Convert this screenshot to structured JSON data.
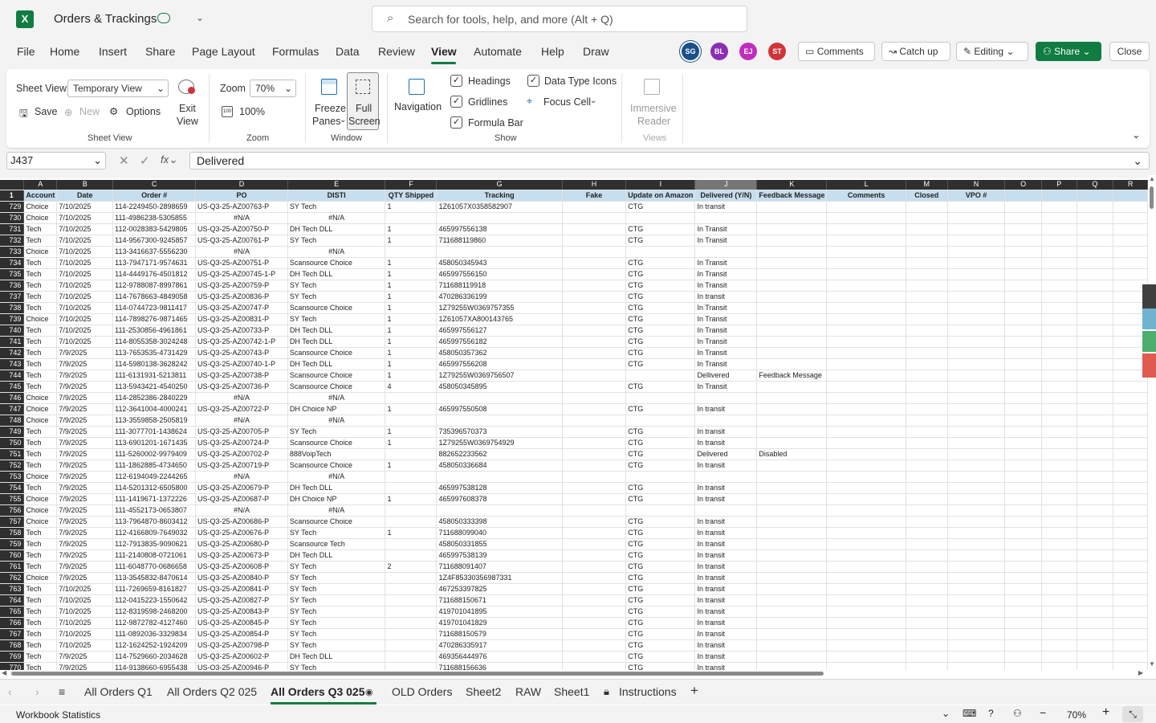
{
  "app": {
    "title": "Orders & Trackings",
    "search_placeholder": "Search for tools, help, and more (Alt + Q)",
    "logo_letter": "X"
  },
  "menu": [
    "File",
    "Home",
    "Insert",
    "Share",
    "Page Layout",
    "Formulas",
    "Data",
    "Review",
    "View",
    "Automate",
    "Help",
    "Draw"
  ],
  "active_menu": "View",
  "avatars": [
    {
      "initials": "SG",
      "color": "#1b4f8a"
    },
    {
      "initials": "BL",
      "color": "#8a2fb5"
    },
    {
      "initials": "EJ",
      "color": "#c02dbd"
    },
    {
      "initials": "ST",
      "color": "#d13438"
    }
  ],
  "top_buttons": {
    "comments": "Comments",
    "catchup": "Catch up",
    "editing": "Editing",
    "share": "Share",
    "close": "Close"
  },
  "ribbon": {
    "sheet_view_label": "Sheet View",
    "sheet_view_value": "Temporary View",
    "save": "Save",
    "new": "New",
    "options": "Options",
    "exit_view_1": "Exit",
    "exit_view_2": "View",
    "group_sheet_view": "Sheet View",
    "zoom_label": "Zoom",
    "zoom_value": "70%",
    "zoom_100": "100%",
    "group_zoom": "Zoom",
    "freeze_1": "Freeze",
    "freeze_2": "Panes",
    "full_1": "Full",
    "full_2": "Screen",
    "group_window": "Window",
    "navigation": "Navigation",
    "headings": "Headings",
    "gridlines": "Gridlines",
    "formula_bar": "Formula Bar",
    "data_type_icons": "Data Type Icons",
    "focus_cell": "Focus Cell",
    "group_show": "Show",
    "immersive_1": "Immersive",
    "immersive_2": "Reader",
    "group_views": "Views"
  },
  "formula_bar": {
    "cell_ref": "J437",
    "value": "Delivered"
  },
  "columns": [
    "A",
    "B",
    "C",
    "D",
    "E",
    "F",
    "G",
    "H",
    "I",
    "J",
    "K",
    "L",
    "M",
    "N",
    "O",
    "P",
    "Q",
    "R"
  ],
  "selected_column": "J",
  "header_row": {
    "row": "1",
    "cells": [
      "Account",
      "Date",
      "Order #",
      "PO",
      "DISTI",
      "QTY Shipped",
      "Tracking",
      "Fake",
      "Update on Amazon",
      "Delivered (Y/N)",
      "Feedback Message",
      "Comments",
      "Closed",
      "VPO #",
      "",
      "",
      "",
      ""
    ]
  },
  "rows": [
    [
      "729",
      "Choice",
      "7/10/2025",
      "114-2249450-2898659",
      "US-Q3-25-AZ00763-P",
      "SY Tech",
      "1",
      "1Z61057X0358582907",
      "",
      "CTG",
      "In transit",
      "",
      "",
      "",
      "",
      "",
      "",
      "",
      ""
    ],
    [
      "730",
      "Choice",
      "7/10/2025",
      "111-4986238-5305855",
      "#N/A",
      "#N/A",
      "",
      "",
      "",
      "",
      "",
      "",
      "",
      "",
      "",
      "",
      "",
      "",
      ""
    ],
    [
      "731",
      "Tech",
      "7/10/2025",
      "112-0028383-5429805",
      "US-Q3-25-AZ00750-P",
      "DH Tech DLL",
      "1",
      "465997556138",
      "",
      "CTG",
      "In Transit",
      "",
      "",
      "",
      "",
      "",
      "",
      "",
      ""
    ],
    [
      "732",
      "Tech",
      "7/10/2025",
      "114-9567300-9245857",
      "US-Q3-25-AZ00761-P",
      "SY Tech",
      "1",
      "711688119860",
      "",
      "CTG",
      "In Transit",
      "",
      "",
      "",
      "",
      "",
      "",
      "",
      ""
    ],
    [
      "733",
      "Choice",
      "7/10/2025",
      "113-3416637-5556230",
      "#N/A",
      "#N/A",
      "",
      "",
      "",
      "",
      "",
      "",
      "",
      "",
      "",
      "",
      "",
      "",
      ""
    ],
    [
      "734",
      "Tech",
      "7/10/2025",
      "113-7947171-9574631",
      "US-Q3-25-AZ00751-P",
      "Scansource Choice",
      "1",
      "458050345943",
      "",
      "CTG",
      "In Transit",
      "",
      "",
      "",
      "",
      "",
      "",
      "",
      ""
    ],
    [
      "735",
      "Tech",
      "7/10/2025",
      "114-4449176-4501812",
      "US-Q3-25-AZ00745-1-P",
      "DH Tech DLL",
      "1",
      "465997556150",
      "",
      "CTG",
      "In Transit",
      "",
      "",
      "",
      "",
      "",
      "",
      "",
      ""
    ],
    [
      "736",
      "Tech",
      "7/10/2025",
      "112-9788087-8997861",
      "US-Q3-25-AZ00759-P",
      "SY Tech",
      "1",
      "711688119918",
      "",
      "CTG",
      "In Transit",
      "",
      "",
      "",
      "",
      "",
      "",
      "",
      ""
    ],
    [
      "737",
      "Tech",
      "7/10/2025",
      "114-7678663-4849058",
      "US-Q3-25-AZ00836-P",
      "SY Tech",
      "1",
      "470286336199",
      "",
      "CTG",
      "In transit",
      "",
      "",
      "",
      "",
      "",
      "",
      "",
      ""
    ],
    [
      "738",
      "Tech",
      "7/10/2025",
      "114-0744723-9811417",
      "US-Q3-25-AZ00747-P",
      "Scansource Choice",
      "1",
      "1Z79255W0369757355",
      "",
      "CTG",
      "In Transit",
      "",
      "",
      "",
      "",
      "",
      "",
      "",
      ""
    ],
    [
      "739",
      "Choice",
      "7/10/2025",
      "114-7898276-9871465",
      "US-Q3-25-AZ00831-P",
      "SY Tech",
      "1",
      "1Z61057XA800143765",
      "",
      "CTG",
      "In Transit",
      "",
      "",
      "",
      "",
      "",
      "",
      "",
      ""
    ],
    [
      "740",
      "Tech",
      "7/10/2025",
      "111-2530856-4961861",
      "US-Q3-25-AZ00733-P",
      "DH Tech DLL",
      "1",
      "465997556127",
      "",
      "CTG",
      "In Transit",
      "",
      "",
      "",
      "",
      "",
      "",
      "",
      ""
    ],
    [
      "741",
      "Tech",
      "7/10/2025",
      "114-8055358-3024248",
      "US-Q3-25-AZ00742-1-P",
      "DH Tech DLL",
      "1",
      "465997556182",
      "",
      "CTG",
      "In Transit",
      "",
      "",
      "",
      "",
      "",
      "",
      "",
      ""
    ],
    [
      "742",
      "Tech",
      "7/9/2025",
      "113-7653535-4731429",
      "US-Q3-25-AZ00743-P",
      "Scansource Choice",
      "1",
      "458050357362",
      "",
      "CTG",
      "In Transit",
      "",
      "",
      "",
      "",
      "",
      "",
      "",
      ""
    ],
    [
      "743",
      "Tech",
      "7/9/2025",
      "114-5980138-3628242",
      "US-Q3-25-AZ00740-1-P",
      "DH Tech DLL",
      "1",
      "465997556208",
      "",
      "CTG",
      "In Transit",
      "",
      "",
      "",
      "",
      "",
      "",
      "",
      ""
    ],
    [
      "744",
      "Tech",
      "7/9/2025",
      "111-6131931-5213811",
      "US-Q3-25-AZ00738-P",
      "Scansource Choice",
      "1",
      "1Z79255W0369756507",
      "",
      "",
      "Dellivered",
      "Feedback Message",
      "",
      "",
      "",
      "",
      "",
      "",
      ""
    ],
    [
      "745",
      "Tech",
      "7/9/2025",
      "113-5943421-4540250",
      "US-Q3-25-AZ00736-P",
      "Scansource Choice",
      "4",
      "458050345895",
      "",
      "CTG",
      "In Transit",
      "",
      "",
      "",
      "",
      "",
      "",
      "",
      ""
    ],
    [
      "746",
      "Choice",
      "7/9/2025",
      "114-2852386-2840229",
      "#N/A",
      "#N/A",
      "",
      "",
      "",
      "",
      "",
      "",
      "",
      "",
      "",
      "",
      "",
      "",
      ""
    ],
    [
      "747",
      "Choice",
      "7/9/2025",
      "112-3641004-4000241",
      "US-Q3-25-AZ00722-P",
      "DH Choice NP",
      "1",
      "465997550508",
      "",
      "CTG",
      "In transit",
      "",
      "",
      "",
      "",
      "",
      "",
      "",
      ""
    ],
    [
      "748",
      "Choice",
      "7/9/2025",
      "113-3559858-2505819",
      "#N/A",
      "#N/A",
      "",
      "",
      "",
      "",
      "",
      "",
      "",
      "",
      "",
      "",
      "",
      "",
      ""
    ],
    [
      "749",
      "Tech",
      "7/9/2025",
      "111-3077701-1438624",
      "US-Q3-25-AZ00705-P",
      "SY Tech",
      "1",
      "735396570373",
      "",
      "CTG",
      "In transit",
      "",
      "",
      "",
      "",
      "",
      "",
      "",
      ""
    ],
    [
      "750",
      "Tech",
      "7/9/2025",
      "113-6901201-1671435",
      "US-Q3-25-AZ00724-P",
      "Scansource Choice",
      "1",
      "1Z79255W0369754929",
      "",
      "CTG",
      "In transit",
      "",
      "",
      "",
      "",
      "",
      "",
      "",
      ""
    ],
    [
      "751",
      "Tech",
      "7/9/2025",
      "111-5260002-9979409",
      "US-Q3-25-AZ00702-P",
      "888VoipTech",
      "",
      "882652233562",
      "",
      "CTG",
      "Delivered",
      "Disabled",
      "",
      "",
      "",
      "",
      "",
      "",
      ""
    ],
    [
      "752",
      "Tech",
      "7/9/2025",
      "111-1862885-4734650",
      "US-Q3-25-AZ00719-P",
      "Scansource Choice",
      "1",
      "458050336684",
      "",
      "CTG",
      "In transit",
      "",
      "",
      "",
      "",
      "",
      "",
      "",
      ""
    ],
    [
      "753",
      "Choice",
      "7/9/2025",
      "112-6194049-2244265",
      "#N/A",
      "#N/A",
      "",
      "",
      "",
      "",
      "",
      "",
      "",
      "",
      "",
      "",
      "",
      "",
      ""
    ],
    [
      "754",
      "Tech",
      "7/9/2025",
      "114-5201312-6505800",
      "US-Q3-25-AZ00679-P",
      "DH Tech DLL",
      "",
      "465997538128",
      "",
      "CTG",
      "In transit",
      "",
      "",
      "",
      "",
      "",
      "",
      "",
      ""
    ],
    [
      "755",
      "Choice",
      "7/9/2025",
      "111-1419671-1372226",
      "US-Q3-25-AZ00687-P",
      "DH Choice NP",
      "1",
      "465997608378",
      "",
      "CTG",
      "In transit",
      "",
      "",
      "",
      "",
      "",
      "",
      "",
      ""
    ],
    [
      "756",
      "Choice",
      "7/9/2025",
      "111-4552173-0653807",
      "#N/A",
      "#N/A",
      "",
      "",
      "",
      "",
      "",
      "",
      "",
      "",
      "",
      "",
      "",
      "",
      ""
    ],
    [
      "757",
      "Choice",
      "7/9/2025",
      "113-7964870-8603412",
      "US-Q3-25-AZ00686-P",
      "Scansource Choice",
      "",
      "458050333398",
      "",
      "CTG",
      "In transit",
      "",
      "",
      "",
      "",
      "",
      "",
      "",
      ""
    ],
    [
      "758",
      "Tech",
      "7/9/2025",
      "112-4166809-7649032",
      "US-Q3-25-AZ00676-P",
      "SY Tech",
      "1",
      "711688099040",
      "",
      "CTG",
      "In transit",
      "",
      "",
      "",
      "",
      "",
      "",
      "",
      ""
    ],
    [
      "759",
      "Tech",
      "7/9/2025",
      "112-7913835-9090621",
      "US-Q3-25-AZ00680-P",
      "Scansource Tech",
      "",
      "458050331855",
      "",
      "CTG",
      "In transit",
      "",
      "",
      "",
      "",
      "",
      "",
      "",
      ""
    ],
    [
      "760",
      "Tech",
      "7/9/2025",
      "111-2140808-0721061",
      "US-Q3-25-AZ00673-P",
      "DH Tech DLL",
      "",
      "465997538139",
      "",
      "CTG",
      "In transit",
      "",
      "",
      "",
      "",
      "",
      "",
      "",
      ""
    ],
    [
      "761",
      "Tech",
      "7/9/2025",
      "111-6048770-0686658",
      "US-Q3-25-AZ00608-P",
      "SY Tech",
      "2",
      "711688091407",
      "",
      "CTG",
      "In transit",
      "",
      "",
      "",
      "",
      "",
      "",
      "",
      ""
    ],
    [
      "762",
      "Choice",
      "7/9/2025",
      "113-3545832-8470614",
      "US-Q3-25-AZ00840-P",
      "SY Tech",
      "",
      "1Z4F85330356987331",
      "",
      "CTG",
      "In transit",
      "",
      "",
      "",
      "",
      "",
      "",
      "",
      ""
    ],
    [
      "763",
      "Tech",
      "7/10/2025",
      "111-7269659-8161827",
      "US-Q3-25-AZ00841-P",
      "SY Tech",
      "",
      "467253397825",
      "",
      "CTG",
      "In transit",
      "",
      "",
      "",
      "",
      "",
      "",
      "",
      ""
    ],
    [
      "764",
      "Tech",
      "7/10/2025",
      "112-0415223-1550642",
      "US-Q3-25-AZ00827-P",
      "SY Tech",
      "",
      "711688150671",
      "",
      "CTG",
      "In transit",
      "",
      "",
      "",
      "",
      "",
      "",
      "",
      ""
    ],
    [
      "765",
      "Tech",
      "7/10/2025",
      "112-8319598-2468200",
      "US-Q3-25-AZ00843-P",
      "SY Tech",
      "",
      "419701041895",
      "",
      "CTG",
      "In transit",
      "",
      "",
      "",
      "",
      "",
      "",
      "",
      ""
    ],
    [
      "766",
      "Tech",
      "7/10/2025",
      "112-9872782-4127460",
      "US-Q3-25-AZ00845-P",
      "SY Tech",
      "",
      "419701041829",
      "",
      "CTG",
      "In transit",
      "",
      "",
      "",
      "",
      "",
      "",
      "",
      ""
    ],
    [
      "767",
      "Tech",
      "7/10/2025",
      "111-0892036-3329834",
      "US-Q3-25-AZ00854-P",
      "SY Tech",
      "",
      "711688150579",
      "",
      "CTG",
      "In transit",
      "",
      "",
      "",
      "",
      "",
      "",
      "",
      ""
    ],
    [
      "768",
      "Tech",
      "7/10/2025",
      "112-1624252-1924209",
      "US-Q3-25-AZ00798-P",
      "SY Tech",
      "",
      "470286335917",
      "",
      "CTG",
      "In transit",
      "",
      "",
      "",
      "",
      "",
      "",
      "",
      ""
    ],
    [
      "769",
      "Tech",
      "7/9/2025",
      "114-7529660-2034628",
      "US-Q3-25-AZ00602-P",
      "DH Tech DLL",
      "",
      "469356444976",
      "",
      "CTG",
      "In transit",
      "",
      "",
      "",
      "",
      "",
      "",
      "",
      ""
    ],
    [
      "770",
      "Tech",
      "7/9/2025",
      "114-9138660-6955438",
      "US-Q3-25-AZ00946-P",
      "SY Tech",
      "",
      "711688156636",
      "",
      "CTG",
      "In transit",
      "",
      "",
      "",
      "",
      "",
      "",
      "",
      ""
    ]
  ],
  "sheet_tabs": [
    "All Orders Q1",
    "All Orders Q2 025",
    "All Orders Q3 025",
    "OLD Orders",
    "Sheet2",
    "RAW",
    "Sheet1",
    "Instructions"
  ],
  "active_tab": "All Orders Q3 025",
  "status": {
    "left": "Workbook Statistics",
    "zoom": "70%"
  }
}
